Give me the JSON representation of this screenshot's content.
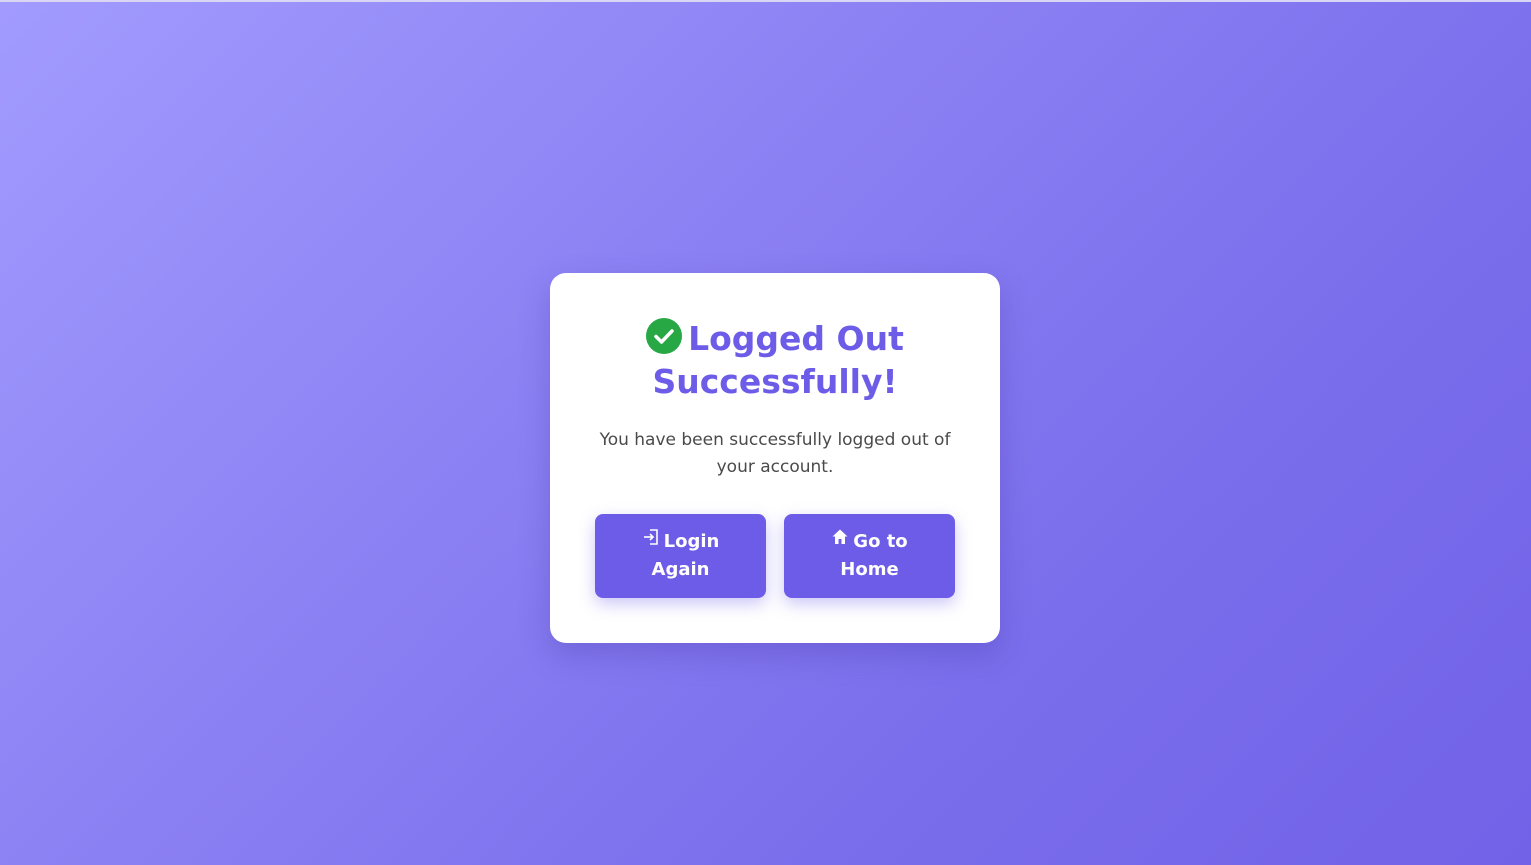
{
  "card": {
    "title": "Logged Out Successfully!",
    "message": "You have been successfully logged out of your account."
  },
  "buttons": {
    "login_label": "Login Again",
    "home_label": "Go to Home"
  },
  "icons": {
    "title_icon": "check-circle-icon",
    "login_icon": "sign-in-icon",
    "home_icon": "home-icon"
  },
  "colors": {
    "accent": "#6c5ce7",
    "success": "#28a745",
    "background_start": "#a29bfe",
    "background_end": "#7262e7"
  }
}
